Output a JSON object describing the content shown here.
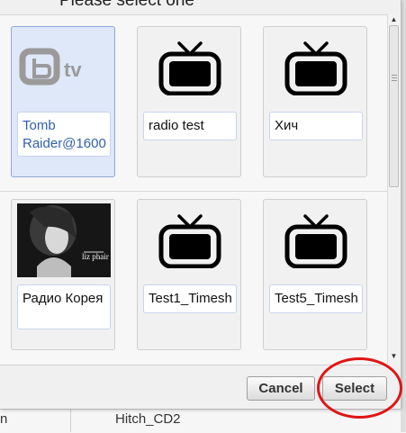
{
  "dialog": {
    "title": "Please select one"
  },
  "items": [
    {
      "label": "Tomb Raider@1600",
      "icon": "btv-logo",
      "selected": true
    },
    {
      "label": "radio  test",
      "icon": "tv-icon",
      "selected": false
    },
    {
      "label": "Хич",
      "icon": "tv-icon",
      "selected": false
    },
    {
      "label": "Радио Корея",
      "icon": "album-cover-photo",
      "cover_text": "liz phair",
      "selected": false
    },
    {
      "label": "Test1_Timesh",
      "icon": "tv-icon",
      "selected": false
    },
    {
      "label": "Test5_Timesh",
      "icon": "tv-icon",
      "selected": false
    }
  ],
  "buttons": {
    "cancel": "Cancel",
    "select": "Select"
  },
  "background": {
    "label_left": "n",
    "label_hitch": "Hitch_CD2"
  },
  "colors": {
    "selected_card": "#dfe8f8",
    "highlight_ring": "#e01515",
    "link_text": "#2f5fb2"
  }
}
